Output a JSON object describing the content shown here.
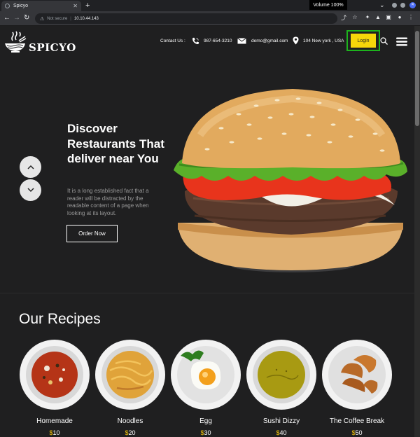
{
  "browser": {
    "tab_title": "Spicyo",
    "new_tab": "+",
    "volume": "Volume 100%",
    "security_label": "Not secure",
    "url": "10.10.44.143"
  },
  "header": {
    "brand": "SPICYO",
    "contact_label": "Contact Us :",
    "phone": "987-654-3210",
    "email": "demo@gmail.com",
    "address": "104 New york , USA",
    "login_label": "Login"
  },
  "hero": {
    "title": "Discover Restaurants That deliver near You",
    "text": "It is a long established fact that a reader will be distracted by the readable content of a page when looking at its layout.",
    "order_label": "Order Now"
  },
  "recipes": {
    "title": "Our Recipes",
    "currency": "$",
    "items": [
      {
        "name": "Homemade",
        "price": "10"
      },
      {
        "name": "Noodles",
        "price": "20"
      },
      {
        "name": "Egg",
        "price": "30"
      },
      {
        "name": "Sushi Dizzy",
        "price": "40"
      },
      {
        "name": "The Coffee Break",
        "price": "50"
      }
    ]
  },
  "colors": {
    "background": "#1f1f20",
    "login_bg": "#f5d60a",
    "login_outline": "#1db31d",
    "price_currency": "#f5c50a"
  }
}
